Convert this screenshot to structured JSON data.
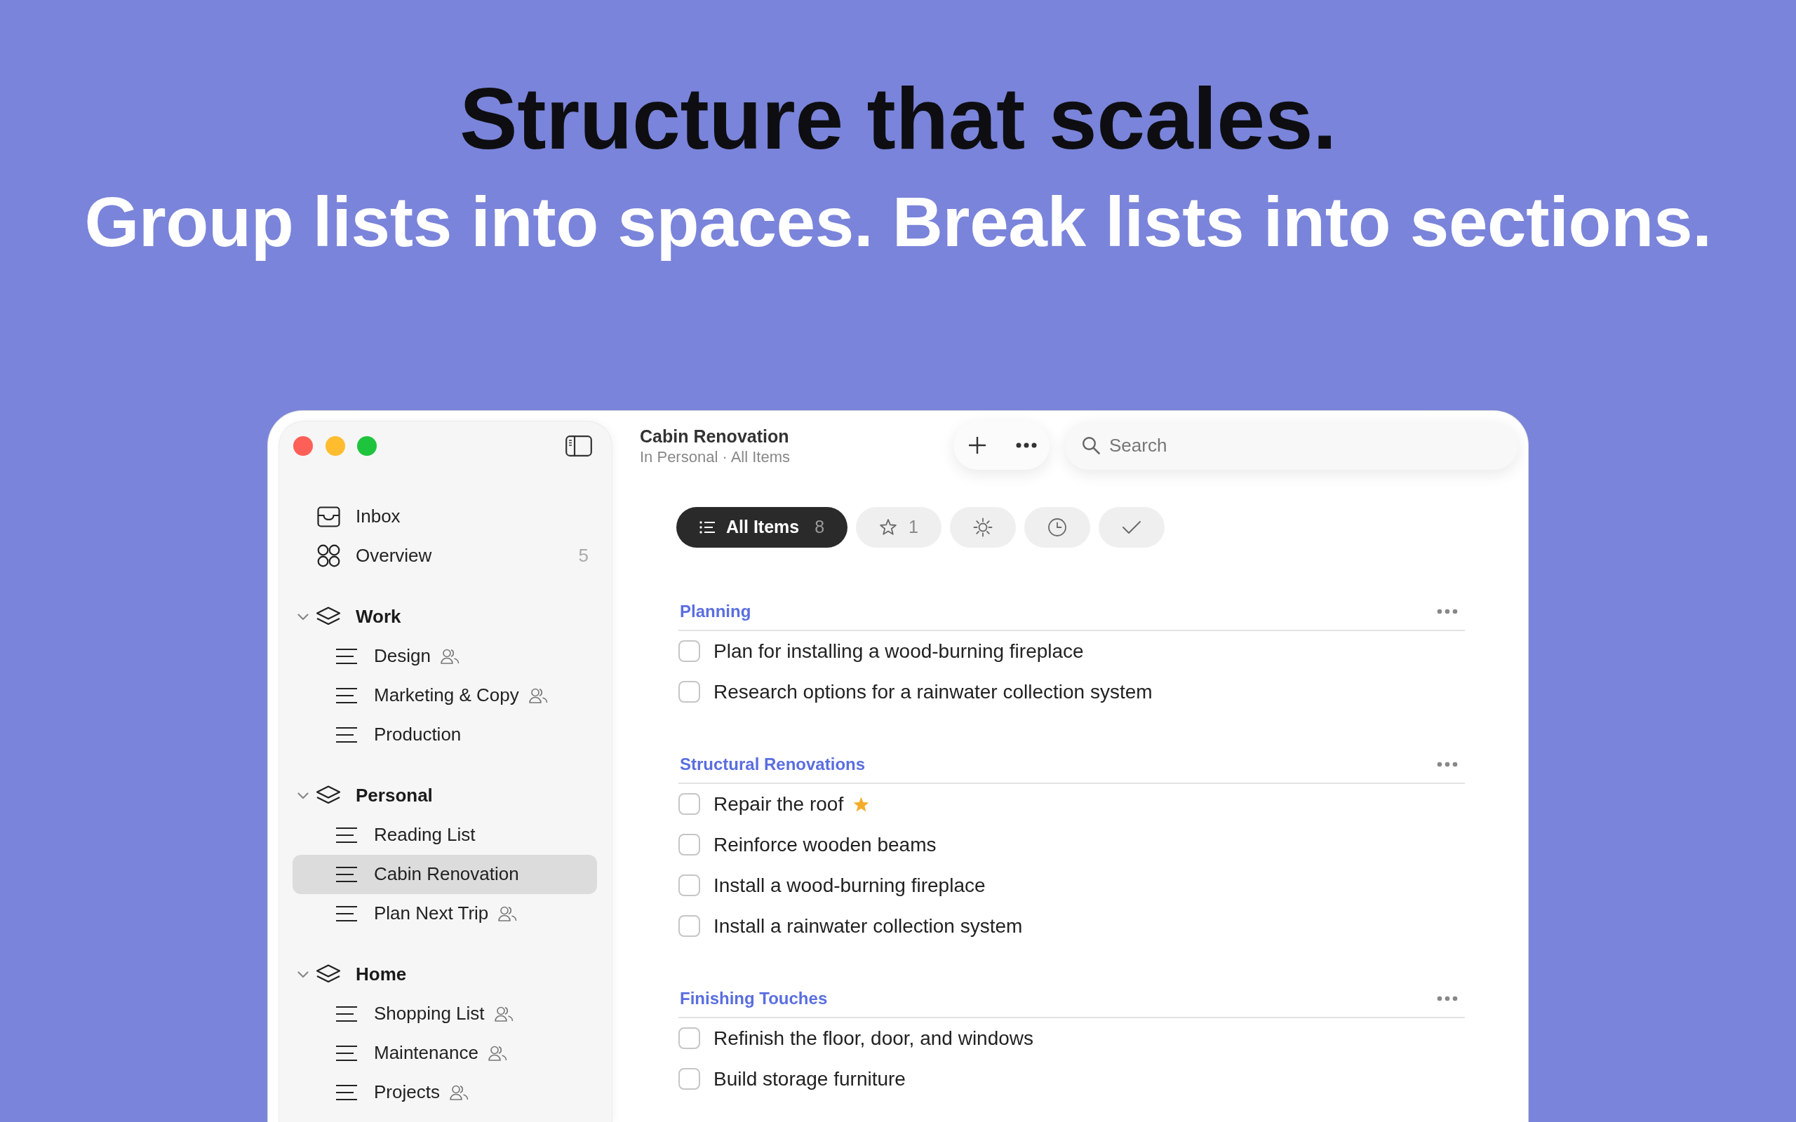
{
  "headline": {
    "title": "Structure that scales.",
    "subtitle": "Group lists into spaces. Break lists into sections."
  },
  "window": {
    "title": "Cabin Renovation",
    "subtitle": "In Personal · All Items"
  },
  "sidebar": {
    "items": [
      {
        "kind": "inbox",
        "label": "Inbox",
        "selected": false
      },
      {
        "kind": "overview",
        "label": "Overview",
        "count": "5",
        "selected": false
      }
    ],
    "spaces": [
      {
        "label": "Work",
        "expanded": true,
        "selected": false,
        "children": [
          {
            "label": "Design",
            "shared": true,
            "selected": false
          },
          {
            "label": "Marketing & Copy",
            "shared": true,
            "selected": false
          },
          {
            "label": "Production",
            "shared": false,
            "selected": false
          }
        ]
      },
      {
        "label": "Personal",
        "expanded": true,
        "selected": false,
        "children": [
          {
            "label": "Reading List",
            "shared": false,
            "selected": false
          },
          {
            "label": "Cabin Renovation",
            "shared": false,
            "selected": true
          },
          {
            "label": "Plan Next Trip",
            "shared": true,
            "selected": false
          }
        ]
      },
      {
        "label": "Home",
        "expanded": true,
        "selected": false,
        "children": [
          {
            "label": "Shopping List",
            "shared": true,
            "selected": false
          },
          {
            "label": "Maintenance",
            "shared": true,
            "selected": false
          },
          {
            "label": "Projects",
            "shared": true,
            "selected": false
          }
        ]
      }
    ]
  },
  "toolbar": {
    "search": {
      "placeholder": "Search"
    }
  },
  "filters": [
    {
      "kind": "all",
      "label": "All Items",
      "count": "8",
      "selected": true
    },
    {
      "kind": "starred",
      "count": "1",
      "selected": false
    },
    {
      "kind": "today",
      "selected": false
    },
    {
      "kind": "scheduled",
      "selected": false
    },
    {
      "kind": "completed",
      "selected": false
    }
  ],
  "sections": [
    {
      "title": "Planning",
      "tasks": [
        {
          "text": "Plan for installing a wood-burning fireplace",
          "checked": false,
          "starred": false
        },
        {
          "text": "Research options for a rainwater collection system",
          "checked": false,
          "starred": false
        }
      ]
    },
    {
      "title": "Structural Renovations",
      "tasks": [
        {
          "text": "Repair the roof",
          "checked": false,
          "starred": true
        },
        {
          "text": "Reinforce wooden beams",
          "checked": false,
          "starred": false
        },
        {
          "text": "Install a wood-burning fireplace",
          "checked": false,
          "starred": false
        },
        {
          "text": "Install a rainwater collection system",
          "checked": false,
          "starred": false
        }
      ]
    },
    {
      "title": "Finishing Touches",
      "tasks": [
        {
          "text": "Refinish the floor, door, and windows",
          "checked": false,
          "starred": false
        },
        {
          "text": "Build storage furniture",
          "checked": false,
          "starred": false
        }
      ]
    }
  ]
}
